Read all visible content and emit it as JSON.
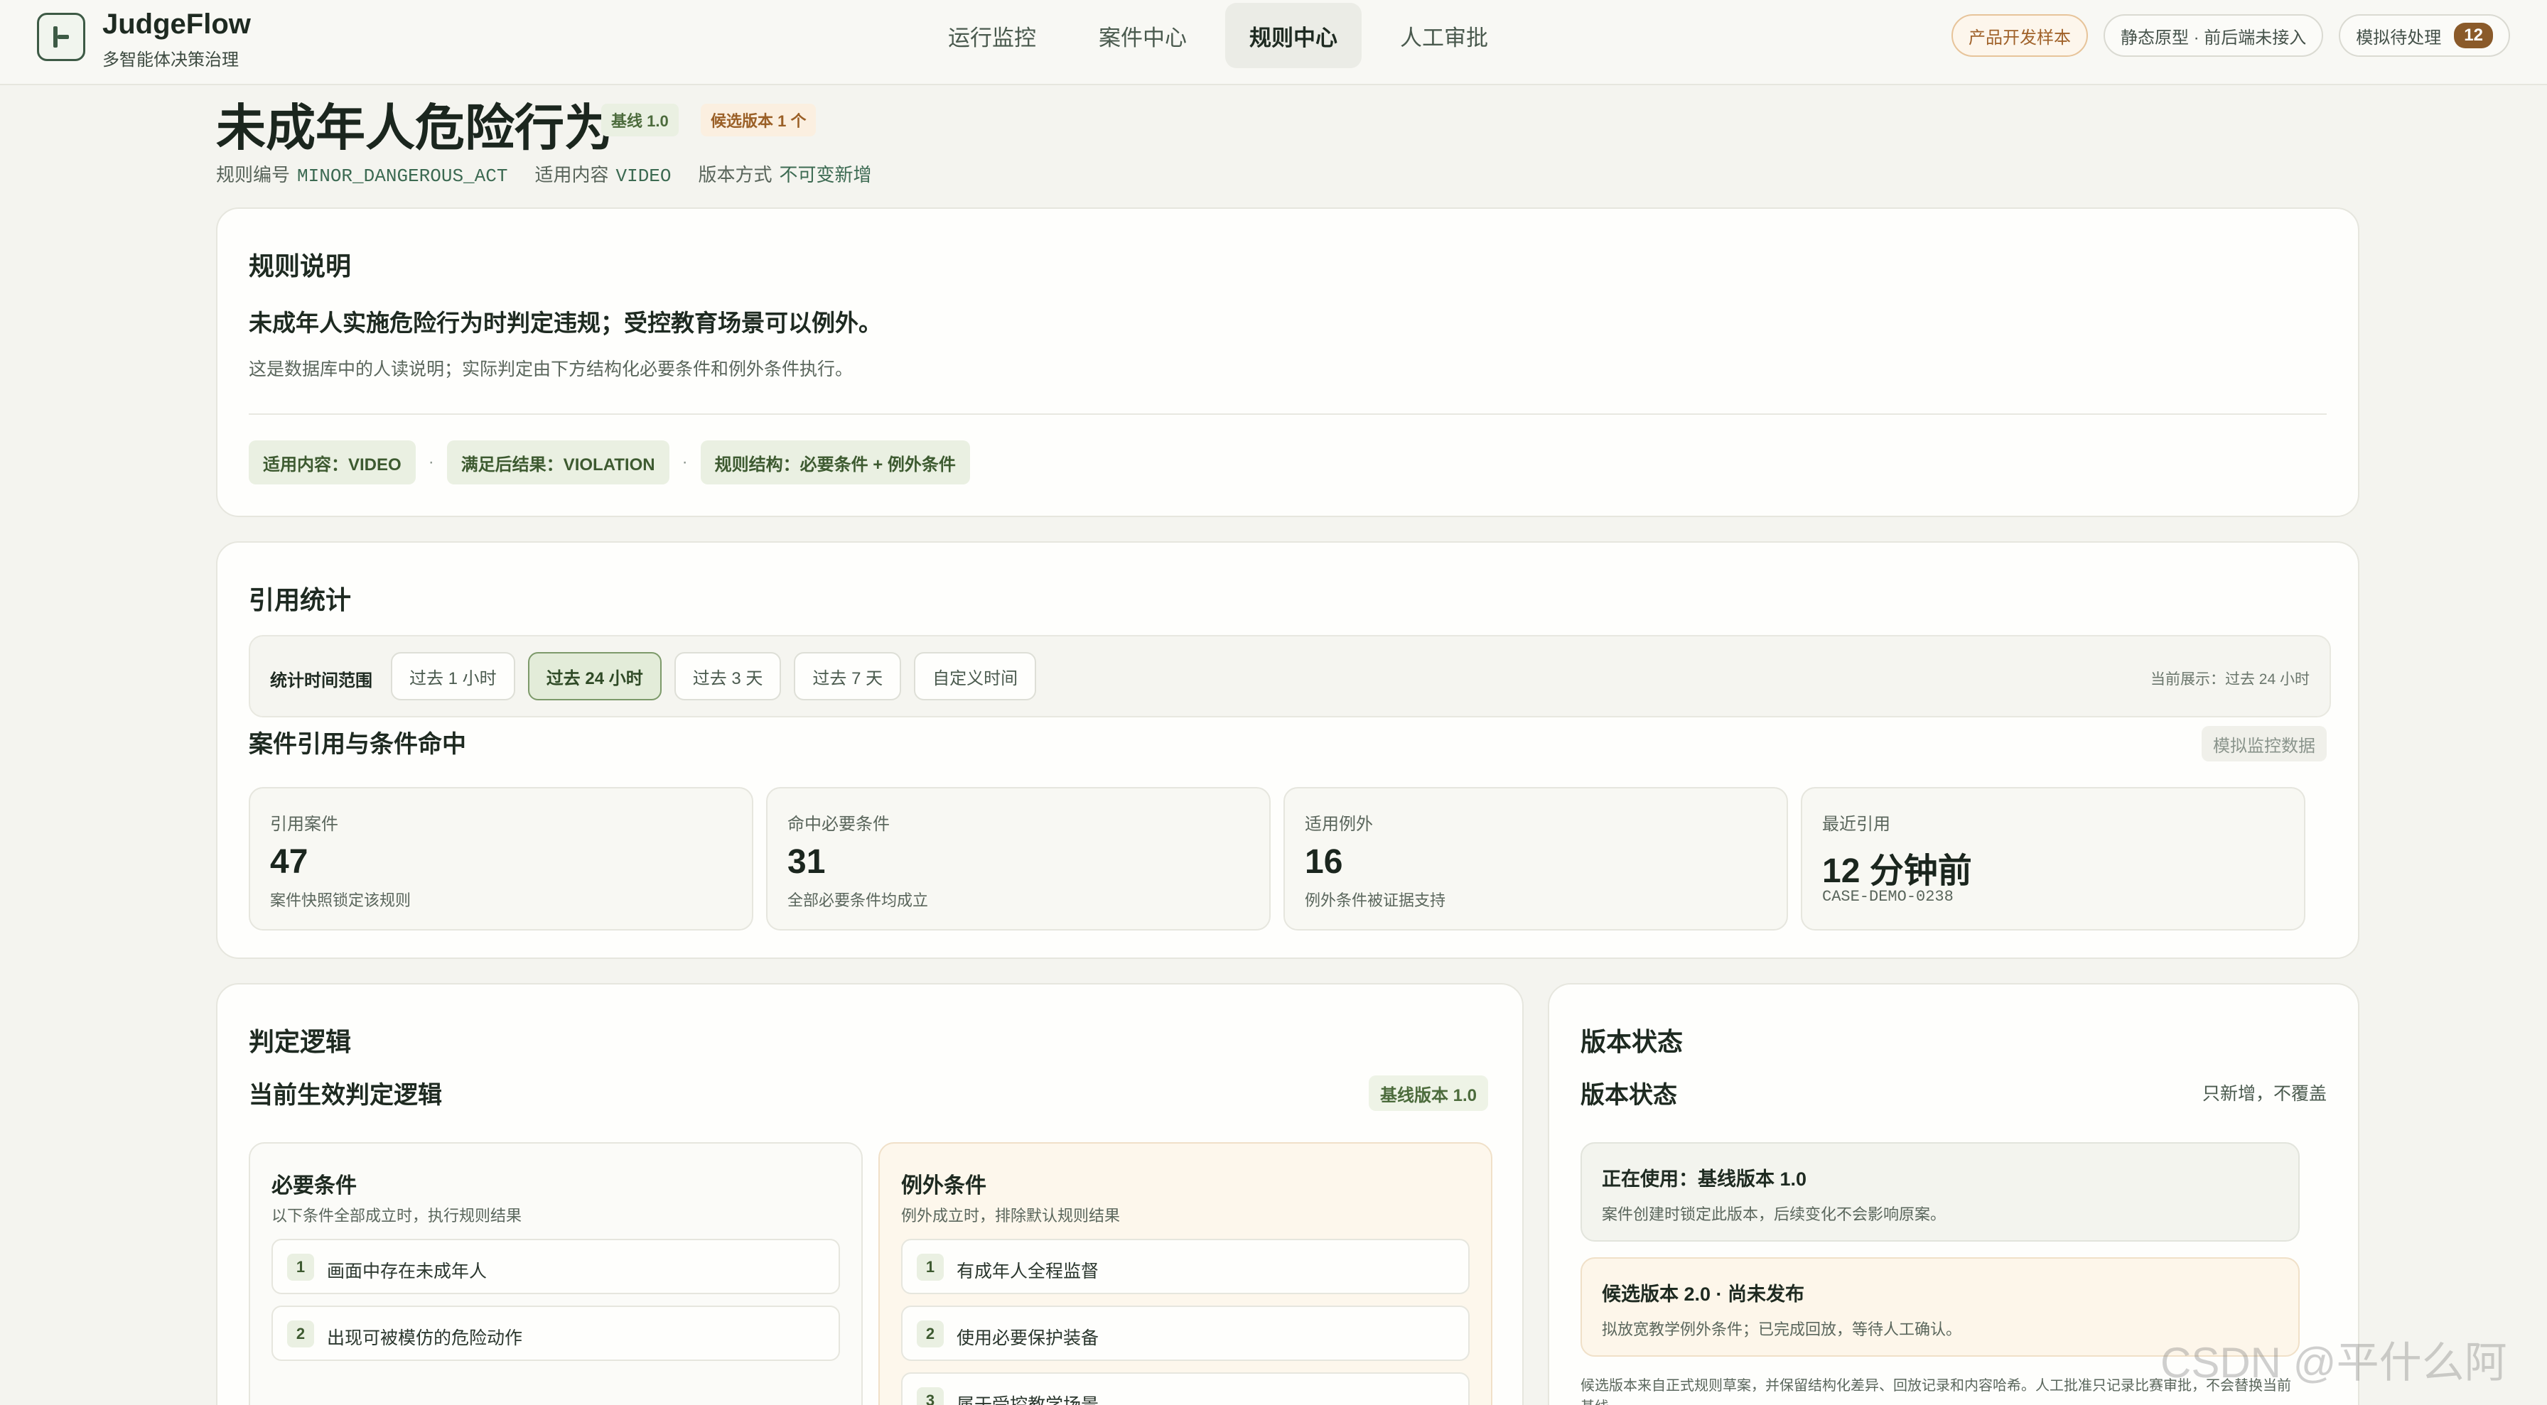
{
  "app": {
    "name": "JudgeFlow",
    "subtitle": "多智能体决策治理"
  },
  "nav": {
    "items": [
      {
        "label": "运行监控"
      },
      {
        "label": "案件中心"
      },
      {
        "label": "规则中心"
      },
      {
        "label": "人工审批"
      }
    ],
    "active": "规则中心"
  },
  "header_chips": {
    "sample": "产品开发样本",
    "prototype": "静态原型 · 前后端未接入",
    "pending_label": "模拟待处理",
    "pending_count": "12"
  },
  "rule": {
    "title": "未成年人危险行为",
    "baseline_tag": "基线 1.0",
    "candidate_tag": "候选版本 1 个",
    "meta": {
      "code_label": "规则编号",
      "code_value": "MINOR_DANGEROUS_ACT",
      "scope_label": "适用内容",
      "scope_value": "VIDEO",
      "version_label": "版本方式",
      "version_value": "不可变新增"
    }
  },
  "rule_desc": {
    "heading": "规则说明",
    "main": "未成年人实施危险行为时判定违规；受控教育场景可以例外。",
    "sub": "这是数据库中的人读说明；实际判定由下方结构化必要条件和例外条件执行。",
    "tags": [
      "适用内容：VIDEO",
      "满足后结果：VIOLATION",
      "规则结构：必要条件 + 例外条件"
    ],
    "separator": "·"
  },
  "stats": {
    "heading": "引用统计",
    "range_label": "统计时间范围",
    "ranges": [
      "过去 1 小时",
      "过去 24 小时",
      "过去 3 天",
      "过去 7 天",
      "自定义时间"
    ],
    "active_range": "过去 24 小时",
    "current": "当前展示：过去 24 小时",
    "subheading": "案件引用与条件命中",
    "mock_badge": "模拟监控数据",
    "cards": [
      {
        "label": "引用案件",
        "value": "47",
        "note": "案件快照锁定该规则"
      },
      {
        "label": "命中必要条件",
        "value": "31",
        "note": "全部必要条件均成立"
      },
      {
        "label": "适用例外",
        "value": "16",
        "note": "例外条件被证据支持"
      },
      {
        "label": "最近引用",
        "value": "12 分钟前",
        "note": "CASE-DEMO-0238"
      }
    ]
  },
  "logic": {
    "heading": "判定逻辑",
    "subheading": "当前生效判定逻辑",
    "badge": "基线版本 1.0",
    "required": {
      "title": "必要条件",
      "sub": "以下条件全部成立时，执行规则结果",
      "items": [
        "画面中存在未成年人",
        "出现可被模仿的危险动作"
      ]
    },
    "exceptions": {
      "title": "例外条件",
      "sub": "例外成立时，排除默认规则结果",
      "items": [
        "有成年人全程监督",
        "使用必要保护装备",
        "属于受控教学场景"
      ]
    }
  },
  "version": {
    "heading": "版本状态",
    "subheading": "版本状态",
    "note": "只新增，不覆盖",
    "current": {
      "title": "正在使用：基线版本 1.0",
      "desc": "案件创建时锁定此版本，后续变化不会影响原案。"
    },
    "candidate": {
      "title": "候选版本 2.0 · 尚未发布",
      "desc": "拟放宽教学例外条件；已完成回放，等待人工确认。"
    },
    "footer": "候选版本来自正式规则草案，并保留结构化差异、回放记录和内容哈希。人工批准只记录比赛审批，不会替换当前基线。"
  },
  "watermark": "CSDN @平什么阿"
}
